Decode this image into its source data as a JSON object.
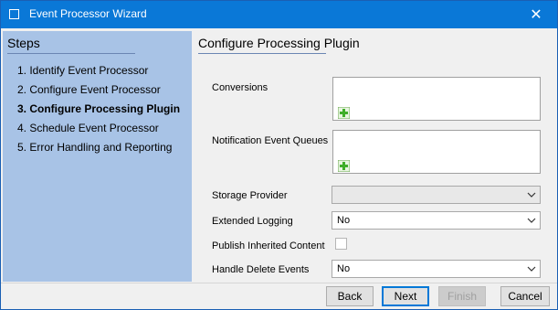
{
  "window": {
    "title": "Event Processor Wizard",
    "close_glyph": "✕"
  },
  "steps": {
    "header": "Steps",
    "items": [
      {
        "label": "1. Identify Event Processor",
        "active": false
      },
      {
        "label": "2. Configure Event Processor",
        "active": false
      },
      {
        "label": "3. Configure Processing Plugin",
        "active": true
      },
      {
        "label": "4. Schedule Event Processor",
        "active": false
      },
      {
        "label": "5. Error Handling and Reporting",
        "active": false
      }
    ]
  },
  "main": {
    "title": "Configure Processing Plugin",
    "fields": {
      "conversions_label": "Conversions",
      "notification_queues_label": "Notification Event Queues",
      "storage_provider_label": "Storage Provider",
      "storage_provider_value": "",
      "extended_logging_label": "Extended Logging",
      "extended_logging_value": "No",
      "publish_inherited_label": "Publish Inherited Content",
      "publish_inherited_checked": false,
      "handle_delete_label": "Handle Delete Events",
      "handle_delete_value": "No"
    }
  },
  "buttons": {
    "back": "Back",
    "next": "Next",
    "finish": "Finish",
    "cancel": "Cancel"
  },
  "colors": {
    "titlebar": "#0a78d7",
    "steps_panel": "#a8c3e6",
    "add_icon_green": "#3fae29"
  }
}
